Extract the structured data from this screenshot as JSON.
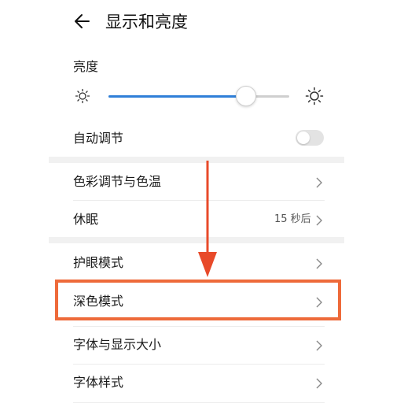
{
  "header": {
    "title": "显示和亮度",
    "back_icon": "arrow-left-icon"
  },
  "brightness": {
    "label": "亮度",
    "level": 0.76,
    "low_icon": "sun-small-icon",
    "high_icon": "sun-large-icon",
    "accent_color": "#2f7fd8"
  },
  "auto_adjust": {
    "label": "自动调节",
    "enabled": false
  },
  "group1": {
    "color_temp": {
      "label": "色彩调节与色温"
    },
    "sleep": {
      "label": "休眠",
      "value": "15 秒后"
    }
  },
  "group2": {
    "eye_comfort": {
      "label": "护眼模式"
    },
    "dark_mode": {
      "label": "深色模式"
    },
    "font_size": {
      "label": "字体与显示大小"
    },
    "font_style": {
      "label": "字体样式"
    }
  },
  "annotation": {
    "highlight_color": "#ee6a3a",
    "arrow_color": "#e84a2a",
    "target": "dark_mode"
  }
}
